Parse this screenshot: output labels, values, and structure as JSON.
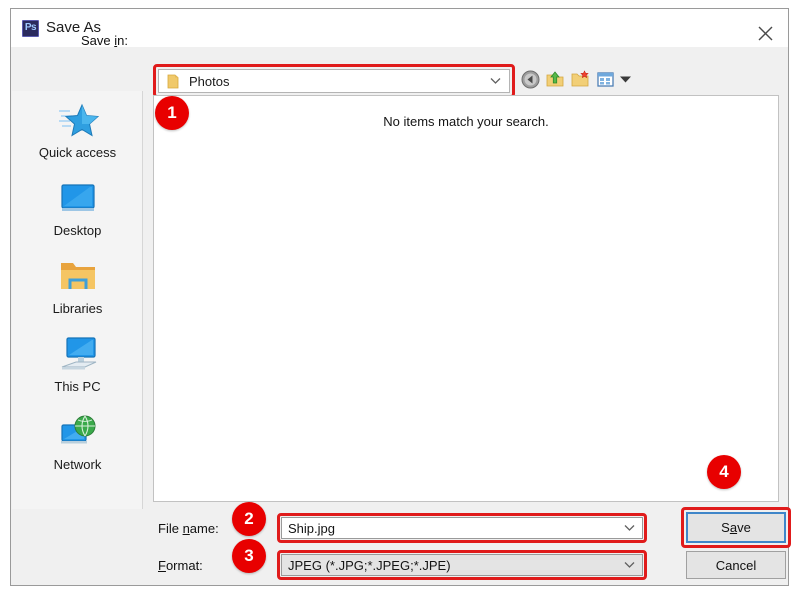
{
  "window": {
    "title": "Save As",
    "app_icon": "photoshop-icon",
    "app_icon_text": "Ps",
    "close_icon": "close-icon"
  },
  "savein": {
    "label_pre": "Save ",
    "label_mnemonic": "i",
    "label_post": "n:",
    "label_full": "Save in:",
    "value": "Photos",
    "folder_icon": "folder-icon",
    "chevron_icon": "chevron-down-icon"
  },
  "toolbar": {
    "icons": [
      {
        "name": "back-icon",
        "label": "Back"
      },
      {
        "name": "up-folder-icon",
        "label": "Up one level"
      },
      {
        "name": "new-folder-icon",
        "label": "Create New Folder"
      },
      {
        "name": "views-icon",
        "label": "Views"
      },
      {
        "name": "views-dropdown-icon",
        "label": "Views menu"
      }
    ]
  },
  "places": {
    "items": [
      {
        "label": "Quick access",
        "icon": "star-icon"
      },
      {
        "label": "Desktop",
        "icon": "monitor-icon"
      },
      {
        "label": "Libraries",
        "icon": "folder-icon"
      },
      {
        "label": "This PC",
        "icon": "computer-icon"
      },
      {
        "label": "Network",
        "icon": "network-globe-icon"
      }
    ]
  },
  "file_list": {
    "empty_message": "No items match your search."
  },
  "form": {
    "filename_label": "File name:",
    "filename_label_pre": "File ",
    "filename_label_mnemonic": "n",
    "filename_label_post": "ame:",
    "filename_value": "Ship.jpg",
    "format_label": "Format:",
    "format_label_mnemonic": "F",
    "format_label_post": "ormat:",
    "format_value": "JPEG (*.JPG;*.JPEG;*.JPE)",
    "chevron_icon": "chevron-down-icon"
  },
  "actions": {
    "save_label": "Save",
    "save_label_pre": "S",
    "save_label_mnemonic": "a",
    "save_label_post": "ve",
    "cancel_label": "Cancel"
  },
  "annotations": {
    "badges": [
      {
        "id": "1",
        "text": "1",
        "target": "file-list"
      },
      {
        "id": "2",
        "text": "2",
        "target": "filename-field"
      },
      {
        "id": "3",
        "text": "3",
        "target": "format-field"
      },
      {
        "id": "4",
        "text": "4",
        "target": "save-button"
      }
    ],
    "highlight_color": "#e01b1b",
    "badge_color": "#e80000"
  }
}
